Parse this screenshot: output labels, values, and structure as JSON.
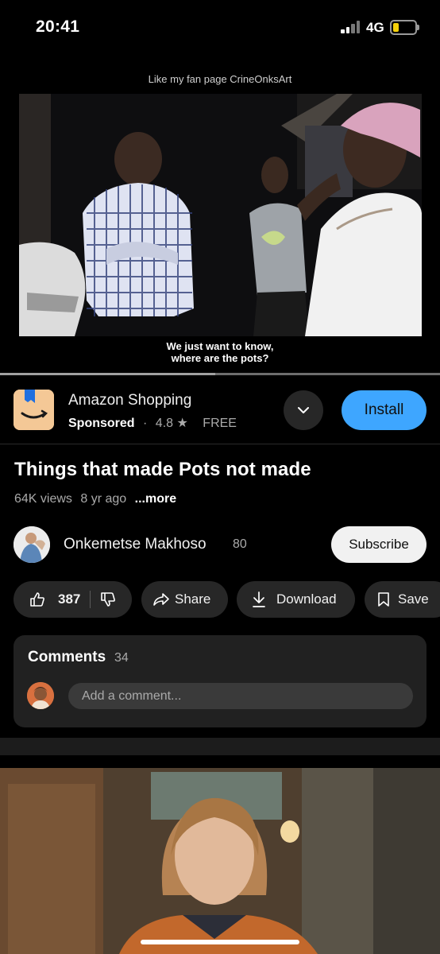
{
  "status_bar": {
    "time": "20:41",
    "network": "4G",
    "battery_color": "#f5d10a"
  },
  "player": {
    "top_caption": "Like my fan page CrineOnksArt",
    "subtitle_line1": "We just want to know,",
    "subtitle_line2": "where are the pots?",
    "progress": 0.49
  },
  "ad": {
    "title": "Amazon Shopping",
    "sponsored": "Sponsored",
    "separator": "·",
    "rating": "4.8",
    "star_icon": "★",
    "price": "FREE",
    "install_label": "Install",
    "accent": "#3ea6ff"
  },
  "video": {
    "title": "Things that made Pots not made",
    "views": "64K views",
    "age": "8 yr ago",
    "more": "...more"
  },
  "channel": {
    "name": "Onkemetse Makhoso",
    "subscribers": "80",
    "subscribe_label": "Subscribe"
  },
  "actions": {
    "likes": "387",
    "share": "Share",
    "download": "Download",
    "save": "Save"
  },
  "comments": {
    "heading": "Comments",
    "count": "34",
    "placeholder": "Add a comment..."
  }
}
